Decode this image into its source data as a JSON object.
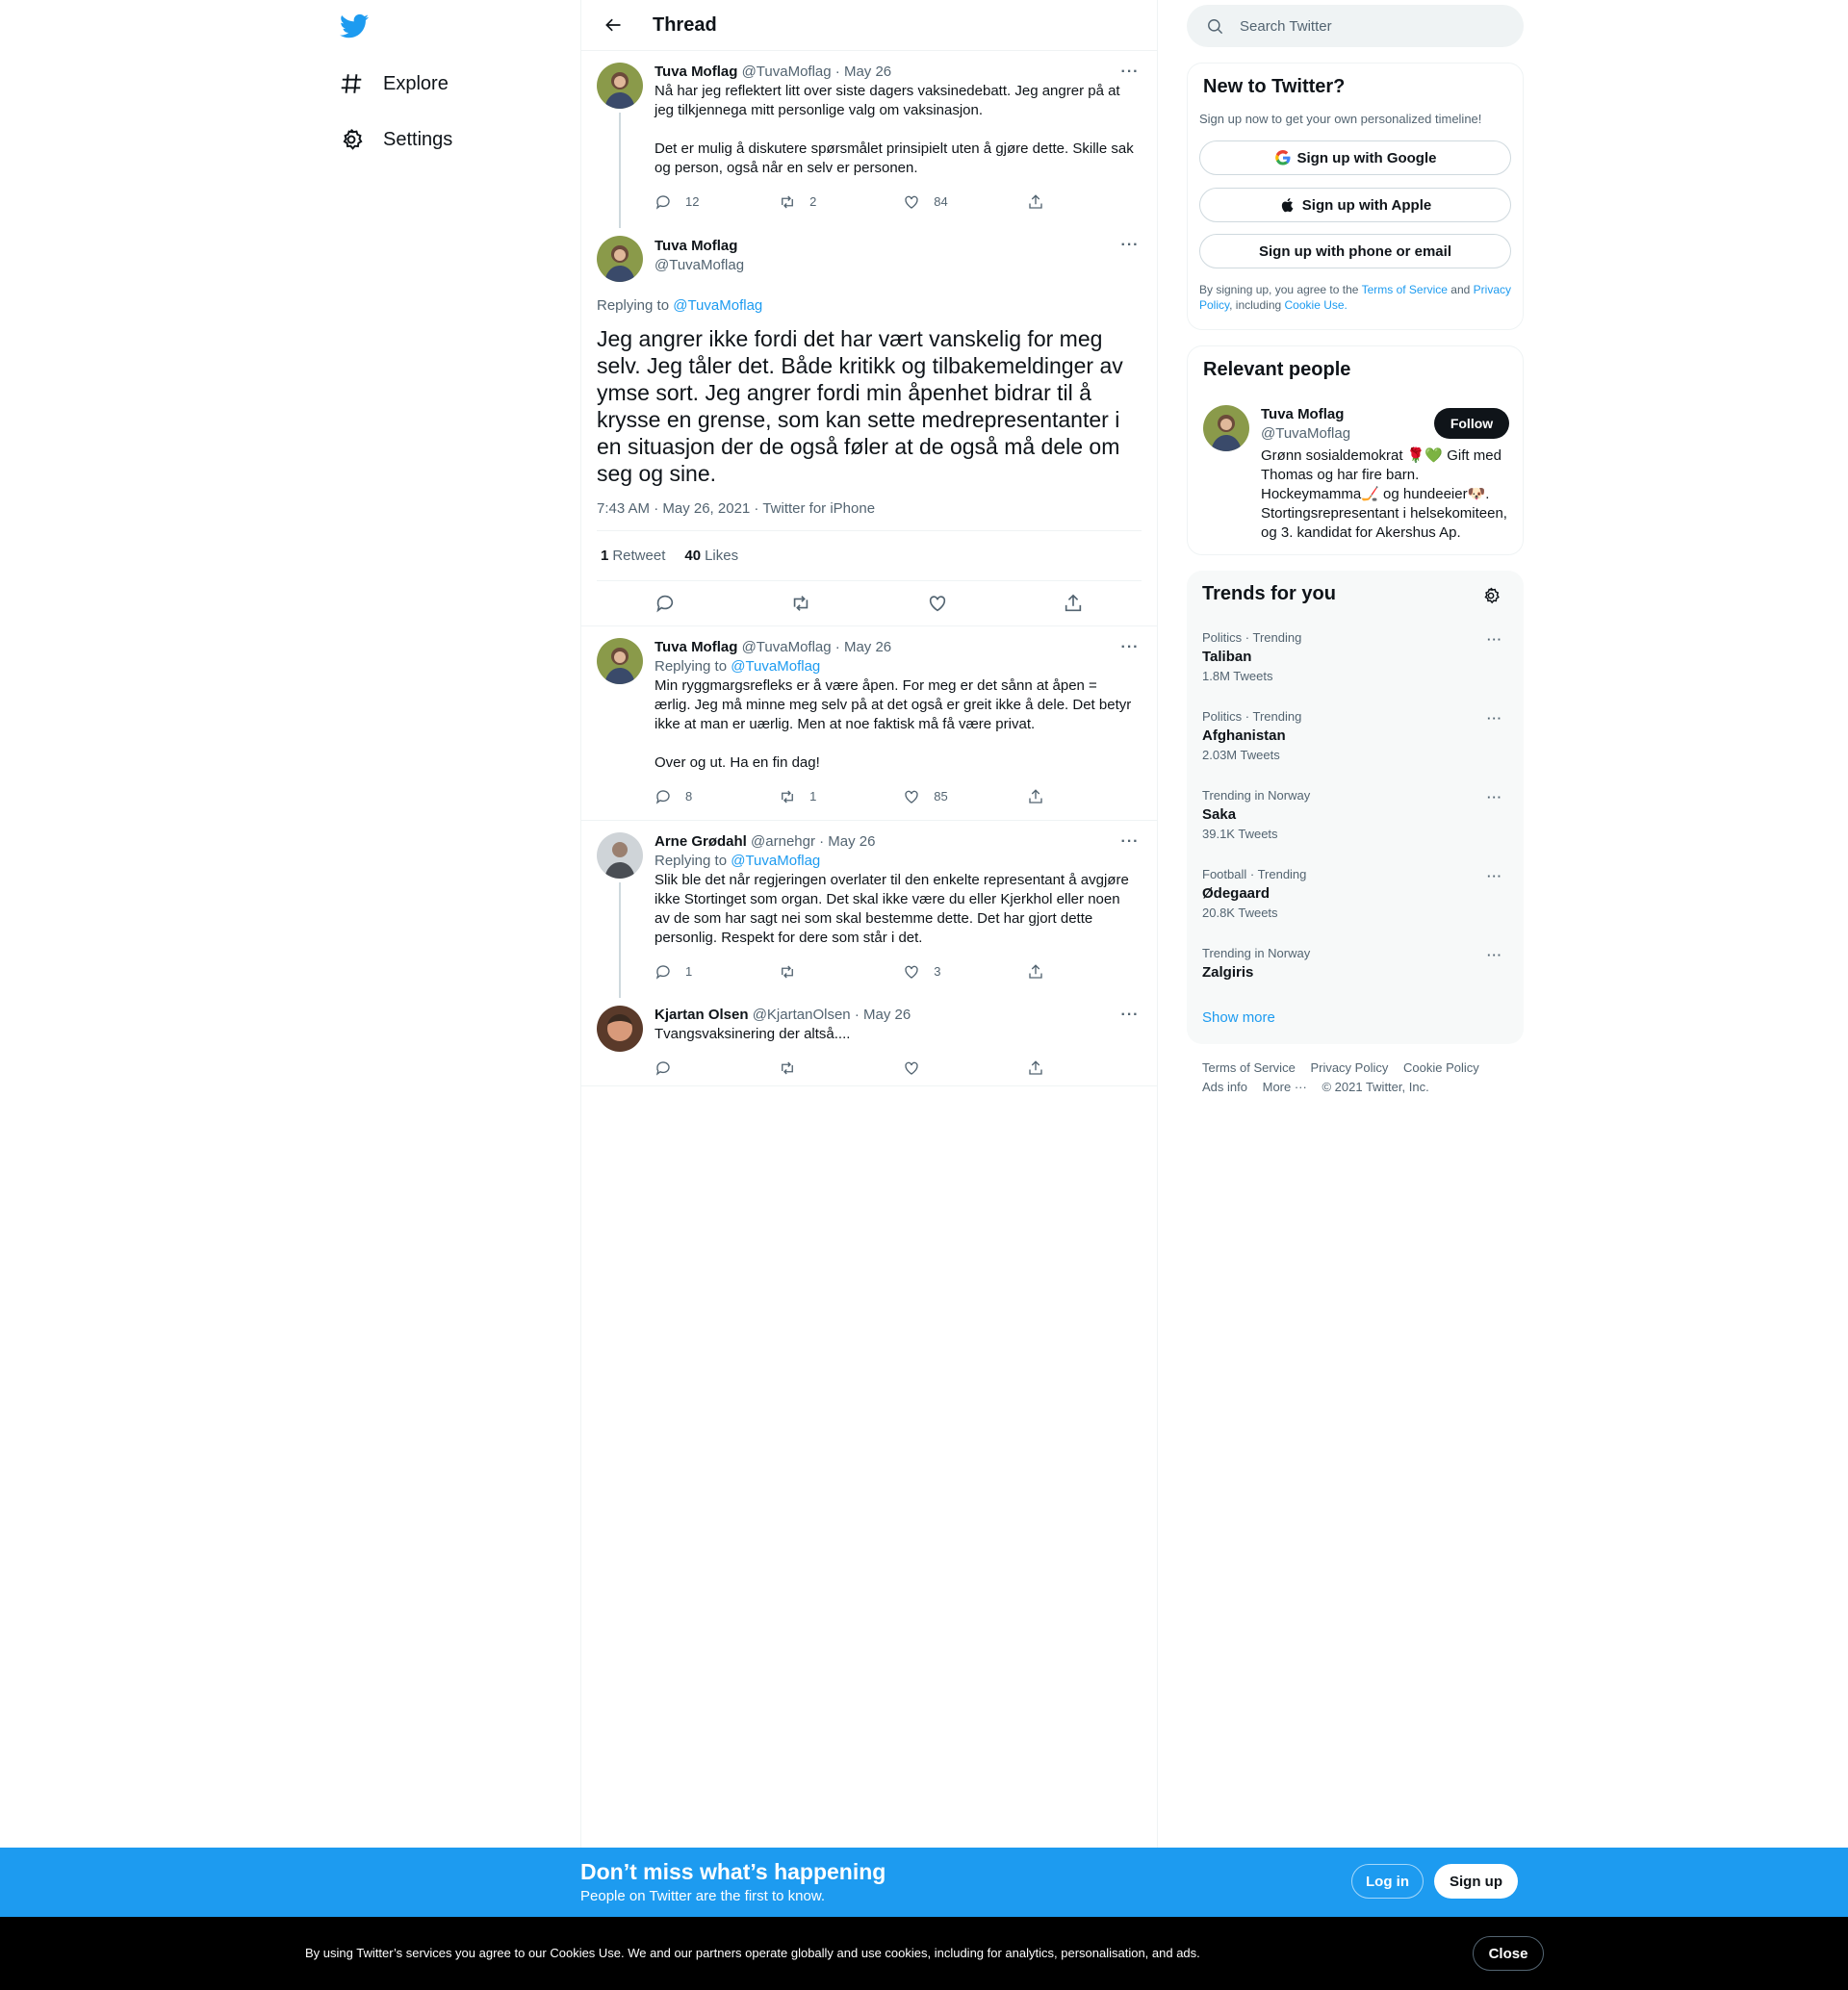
{
  "nav": {
    "items": [
      {
        "label": "Explore",
        "icon": "hashtag-icon"
      },
      {
        "label": "Settings",
        "icon": "gear-icon"
      }
    ]
  },
  "header": {
    "title": "Thread"
  },
  "tweets": {
    "t1": {
      "name": "Tuva Moflag",
      "handle": "@TuvaMoflag",
      "date": "· May 26",
      "p1": "Nå har jeg reflektert litt over siste dagers vaksinedebatt. Jeg angrer på at jeg tilkjennega mitt personlige valg om vaksinasjon.",
      "p2": "Det er mulig å diskutere spørsmålet prinsipielt uten å gjøre dette. Skille sak og person, også når en selv er personen.",
      "replies": "12",
      "retweets": "2",
      "likes": "84"
    },
    "focus": {
      "name": "Tuva Moflag",
      "handle": "@TuvaMoflag",
      "replying_label": "Replying to",
      "replying_to": "@TuvaMoflag",
      "text": "Jeg angrer ikke fordi det har vært vanskelig for meg selv. Jeg tåler det. Både kritikk og tilbakemeldinger av ymse sort. Jeg angrer fordi min åpenhet bidrar til å krysse en grense, som kan sette medrepresentanter i en situasjon der de også føler at de også må dele om seg og sine.",
      "meta": "7:43 AM · May 26, 2021 · Twitter for iPhone",
      "retweet_count": "1",
      "retweet_label": "Retweet",
      "like_count": "40",
      "like_label": "Likes"
    },
    "t3": {
      "name": "Tuva Moflag",
      "handle": "@TuvaMoflag",
      "date": "· May 26",
      "replying_label": "Replying to",
      "replying_to": "@TuvaMoflag",
      "p1": "Min ryggmargsrefleks er å være åpen. For meg er det sånn at åpen = ærlig. Jeg må minne meg selv på at det også er greit ikke å dele. Det betyr ikke at man er uærlig. Men at noe faktisk må få være privat.",
      "p2": "Over og ut. Ha en fin dag!",
      "replies": "8",
      "retweets": "1",
      "likes": "85"
    },
    "t4": {
      "name": "Arne Grødahl",
      "handle": "@arnehgr",
      "date": "· May 26",
      "replying_label": "Replying to",
      "replying_to": "@TuvaMoflag",
      "p1": "Slik ble det når regjeringen overlater til den enkelte representant å avgjøre ikke Stortinget som organ. Det skal ikke være du eller Kjerkhol eller noen av de som har sagt nei som skal bestemme dette. Det har gjort dette personlig. Respekt for dere som står i det.",
      "replies": "1",
      "retweets": "",
      "likes": "3"
    },
    "t5": {
      "name": "Kjartan Olsen",
      "handle": "@KjartanOlsen",
      "date": "· May 26",
      "p1": "Tvangsvaksinering der altså....",
      "replies": "",
      "retweets": "",
      "likes": ""
    }
  },
  "search": {
    "placeholder": "Search Twitter"
  },
  "new_to_twitter": {
    "title": "New to Twitter?",
    "subtitle": "Sign up now to get your own personalized timeline!",
    "google": "Sign up with Google",
    "apple": "Sign up with Apple",
    "phone": "Sign up with phone or email",
    "legal_1": "By signing up, you agree to the",
    "tos": "Terms of Service",
    "and": "and",
    "privacy": "Privacy Policy",
    "including": ", including",
    "cookie": "Cookie Use."
  },
  "relevant": {
    "title": "Relevant people",
    "name": "Tuva Moflag",
    "handle": "@TuvaMoflag",
    "follow": "Follow",
    "bio": "Grønn sosialdemokrat 🌹💚 Gift med Thomas og har fire barn. Hockeymamma🏒 og hundeeier🐶. Stortingsrepresentant i helsekomiteen, og 3. kandidat for Akershus Ap."
  },
  "trends": {
    "title": "Trends for you",
    "items": [
      {
        "context": "Politics · Trending",
        "name": "Taliban",
        "count": "1.8M Tweets"
      },
      {
        "context": "Politics · Trending",
        "name": "Afghanistan",
        "count": "2.03M Tweets"
      },
      {
        "context": "Trending in Norway",
        "name": "Saka",
        "count": "39.1K Tweets"
      },
      {
        "context": "Football · Trending",
        "name": "Ødegaard",
        "count": "20.8K Tweets"
      },
      {
        "context": "Trending in Norway",
        "name": "Zalgiris",
        "count": ""
      }
    ],
    "show_more": "Show more"
  },
  "footer": {
    "tos": "Terms of Service",
    "privacy": "Privacy Policy",
    "cookie": "Cookie Policy",
    "ads": "Ads info",
    "more": "More ···",
    "copyright": "© 2021 Twitter, Inc."
  },
  "signup_bar": {
    "title": "Don’t miss what’s happening",
    "subtitle": "People on Twitter are the first to know.",
    "login": "Log in",
    "signup": "Sign up"
  },
  "cookie_bar": {
    "text": "By using Twitter’s services you agree to our Cookies Use. We and our partners operate globally and use cookies, including for analytics, personalisation, and ads.",
    "close": "Close"
  },
  "colors": {
    "accent": "#1d9bf0",
    "text": "#0f1419",
    "secondary": "#536471"
  }
}
